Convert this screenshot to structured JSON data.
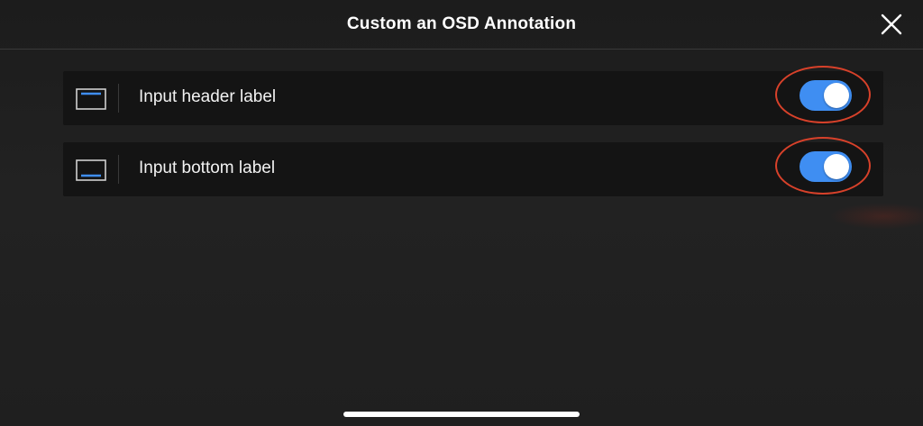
{
  "header": {
    "title": "Custom an OSD Annotation",
    "close_icon": "close-icon"
  },
  "rows": [
    {
      "icon": "header-position-icon",
      "label": "Input header label",
      "toggle_on": true
    },
    {
      "icon": "bottom-position-icon",
      "label": "Input bottom label",
      "toggle_on": true
    }
  ],
  "colors": {
    "toggle_on": "#3f8ef2",
    "highlight_ring": "#d7412a",
    "row_background": "#141414",
    "icon_accent": "#3f8ef2"
  }
}
